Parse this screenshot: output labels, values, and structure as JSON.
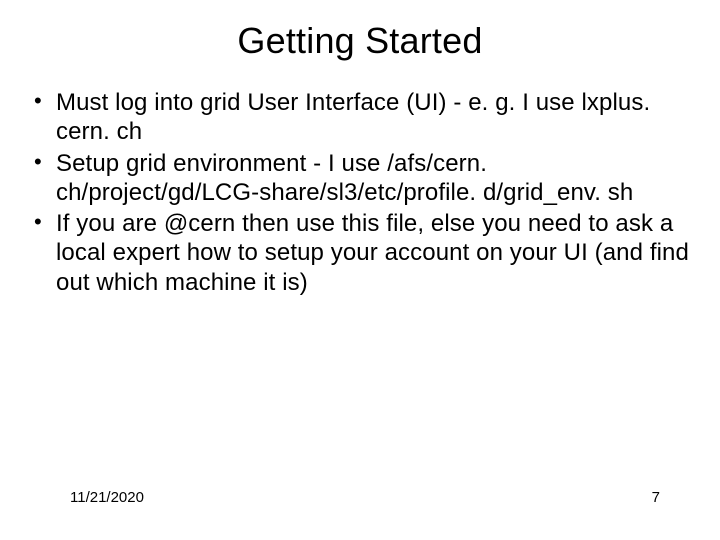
{
  "title": "Getting Started",
  "bullets": [
    "Must log into grid User Interface (UI) - e. g. I use lxplus. cern. ch",
    "Setup grid environment - I use /afs/cern. ch/project/gd/LCG-share/sl3/etc/profile. d/grid_env. sh",
    "If you are @cern then use this file, else you need to ask a local expert how to setup your account on your UI (and find out which machine it is)"
  ],
  "footer": {
    "date": "11/21/2020",
    "page": "7"
  }
}
